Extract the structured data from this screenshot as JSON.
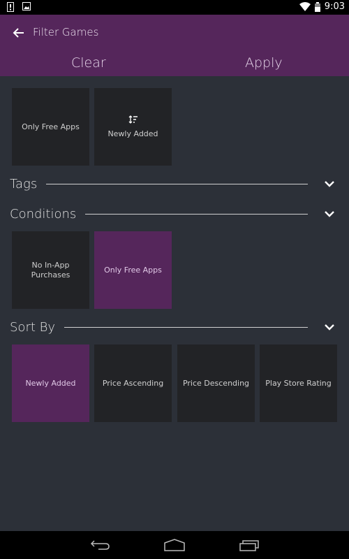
{
  "status_bar": {
    "time": "9:03",
    "left_icons": [
      "notification-alert-icon",
      "image-icon"
    ],
    "right_icons": [
      "wifi-icon",
      "battery-icon"
    ]
  },
  "app_bar": {
    "title": "Filter Games",
    "back_icon": "arrow-back-icon",
    "actions": {
      "clear": "Clear",
      "apply": "Apply"
    }
  },
  "quick_tiles": [
    {
      "label": "Only Free Apps",
      "selected": false
    },
    {
      "label": "Newly Added",
      "icon": "sort-icon",
      "selected": false
    }
  ],
  "sections": {
    "tags": {
      "label": "Tags"
    },
    "conditions": {
      "label": "Conditions",
      "options": [
        {
          "label": "No In-App Purchases",
          "selected": false
        },
        {
          "label": "Only Free Apps",
          "selected": true
        }
      ]
    },
    "sort_by": {
      "label": "Sort By",
      "options": [
        {
          "label": "Newly Added",
          "selected": true
        },
        {
          "label": "Price Ascending",
          "selected": false
        },
        {
          "label": "Price Descending",
          "selected": false
        },
        {
          "label": "Play Store Rating",
          "selected": false
        }
      ]
    }
  },
  "colors": {
    "accent": "#55265b",
    "background": "#2c3038",
    "tile": "#222326"
  },
  "nav_bar": [
    "back-nav-icon",
    "home-nav-icon",
    "recents-nav-icon"
  ]
}
